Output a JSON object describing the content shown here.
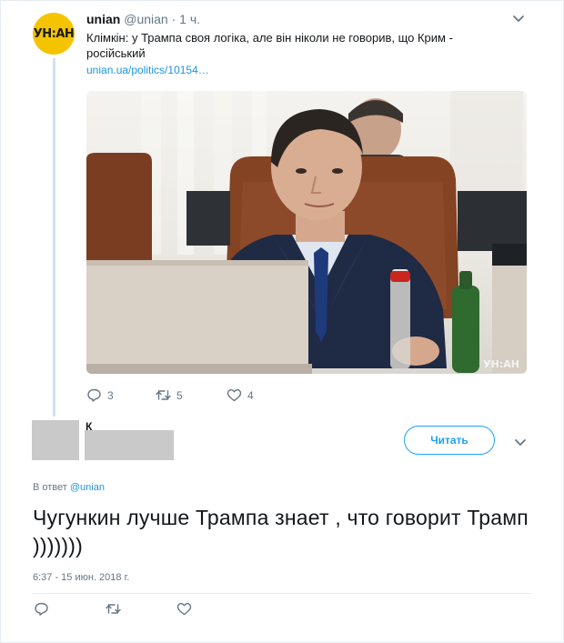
{
  "tweet1": {
    "avatar_text": "УН:АН",
    "name": "unian",
    "handle": "@unian",
    "time": "1 ч.",
    "text": "Клімкін: у Трампа своя логіка, але він ніколи не говорив, що Крим - російський",
    "link": "unian.ua/politics/10154…",
    "watermark": "УН:АН",
    "replies": "3",
    "retweets": "5",
    "likes": "4"
  },
  "tweet2": {
    "name_glimpse": "К",
    "follow_label": "Читать",
    "reply_prefix": "В ответ",
    "reply_mention": "@unian",
    "text": "Чугункин лучше Трампа знает , что говорит Трамп )))))))",
    "timestamp": "6:37 - 15 июн. 2018 г."
  },
  "colors": {
    "accent": "#1da1f2",
    "link": "#1b95e0",
    "muted": "#657786",
    "unian_yellow": "#f5c400"
  },
  "icons": [
    "reply-icon",
    "retweet-icon",
    "like-icon",
    "chevron-down-icon"
  ]
}
